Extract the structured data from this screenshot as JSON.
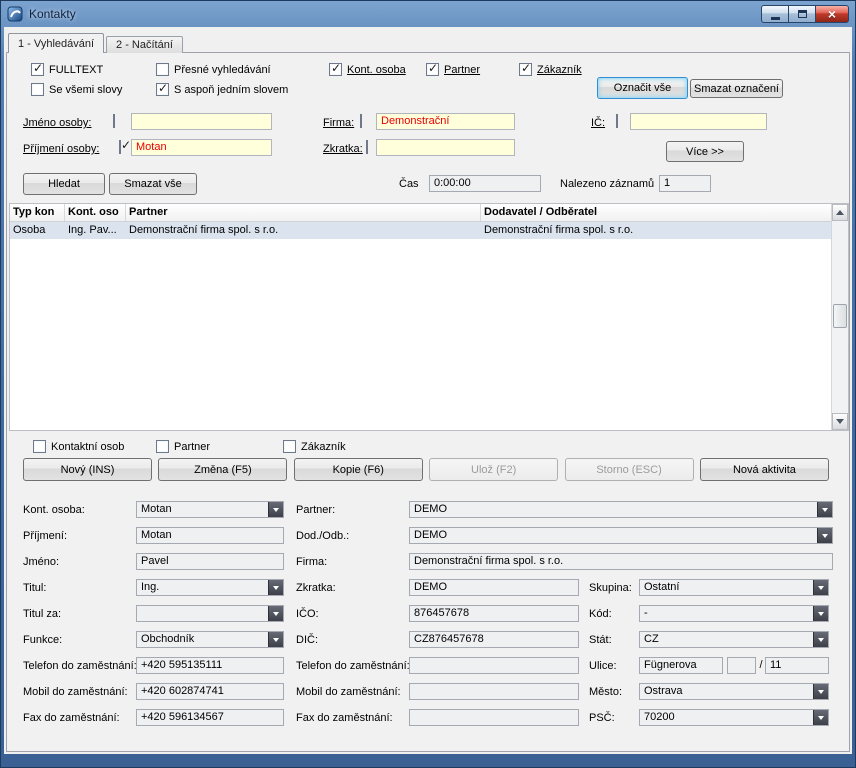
{
  "window": {
    "title": "Kontakty"
  },
  "tabs": [
    {
      "label": "1 - Vyhledávání"
    },
    {
      "label": "2 - Načítání"
    }
  ],
  "checks_top": [
    {
      "label": "FULLTEXT",
      "checked": true
    },
    {
      "label": "Přesné vyhledávání",
      "checked": false
    },
    {
      "label": "Kont. osoba",
      "checked": true
    },
    {
      "label": "Partner",
      "checked": true
    },
    {
      "label": "Zákazník",
      "checked": true
    },
    {
      "label": "Se všemi slovy",
      "checked": false
    },
    {
      "label": "S aspoň jedním slovem",
      "checked": true
    }
  ],
  "top_buttons": {
    "select_all": "Označit vše",
    "clear_selection": "Smazat označení",
    "more": "Více >>",
    "search": "Hledat",
    "clear_all": "Smazat vše"
  },
  "search_fields": {
    "jmeno": {
      "label": "Jméno osoby:",
      "value": "",
      "checked": false
    },
    "prijmeni": {
      "label": "Příjmení osoby:",
      "value": "Motan",
      "checked": true
    },
    "firma": {
      "label": "Firma:",
      "value": "Demonstrační",
      "checked": false
    },
    "zkratka": {
      "label": "Zkratka:",
      "value": "",
      "checked": false
    },
    "ic": {
      "label": "IČ:",
      "value": "",
      "checked": false
    }
  },
  "status": {
    "time_label": "Čas",
    "time_value": "0:00:00",
    "found_label": "Nalezeno záznamů",
    "found_value": "1"
  },
  "table": {
    "columns": [
      "Typ kon",
      "Kont. oso",
      "Partner",
      "Dodavatel / Odběratel"
    ],
    "rows": [
      {
        "cells": [
          "Osoba",
          "Ing. Pav...",
          "Demonstrační firma spol. s r.o.",
          "Demonstrační firma spol. s r.o."
        ]
      }
    ]
  },
  "checks_bottom": [
    {
      "label": "Kontaktní osob",
      "checked": false
    },
    {
      "label": "Partner",
      "checked": false
    },
    {
      "label": "Zákazník",
      "checked": false
    }
  ],
  "action_buttons": [
    {
      "label": "Nový (INS)",
      "enabled": true
    },
    {
      "label": "Změna (F5)",
      "enabled": true
    },
    {
      "label": "Kopie (F6)",
      "enabled": true
    },
    {
      "label": "Ulož (F2)",
      "enabled": false
    },
    {
      "label": "Storno (ESC)",
      "enabled": false
    },
    {
      "label": "Nová aktivita",
      "enabled": true
    }
  ],
  "detail": {
    "street_separator": "/",
    "left": [
      {
        "label": "Kont. osoba:",
        "value": "Motan"
      },
      {
        "label": "Příjmení:",
        "value": "Motan"
      },
      {
        "label": "Jméno:",
        "value": "Pavel"
      },
      {
        "label": "Titul:",
        "value": "Ing."
      },
      {
        "label": "Titul za:",
        "value": ""
      },
      {
        "label": "Funkce:",
        "value": "Obchodník"
      },
      {
        "label": "Telefon do zaměstnání:",
        "value": "+420 595135111"
      },
      {
        "label": "Mobil do zaměstnání:",
        "value": "+420 602874741"
      },
      {
        "label": "Fax do zaměstnání:",
        "value": "+420 596134567"
      }
    ],
    "middle": [
      {
        "label": "Partner:",
        "value": "DEMO"
      },
      {
        "label": "Dod./Odb.:",
        "value": "DEMO"
      },
      {
        "label": "Firma:",
        "value": "Demonstrační firma spol. s r.o."
      },
      {
        "label": "Zkratka:",
        "value": "DEMO"
      },
      {
        "label": "IČO:",
        "value": "876457678"
      },
      {
        "label": "DIČ:",
        "value": "CZ876457678"
      },
      {
        "label": "Telefon do zaměstnání:",
        "value": ""
      },
      {
        "label": "Mobil do zaměstnání:",
        "value": ""
      },
      {
        "label": "Fax do zaměstnání:",
        "value": ""
      }
    ],
    "right": [
      {
        "label": "Skupina:",
        "value": "Ostatní"
      },
      {
        "label": "Kód:",
        "value": "-"
      },
      {
        "label": "Stát:",
        "value": "CZ"
      },
      {
        "label": "Ulice:",
        "value": "Fügnerova",
        "value2": "",
        "value3": "11"
      },
      {
        "label": "Město:",
        "value": "Ostrava"
      },
      {
        "label": "PSČ:",
        "value": "70200"
      }
    ]
  },
  "colors": {
    "titlebar_blue": "#40699f",
    "default_button_glow": "#8bd5f5",
    "search_input_yellow": "#ffffdc",
    "search_text_red": "#e60000",
    "selected_row": "#dbe4ee"
  }
}
